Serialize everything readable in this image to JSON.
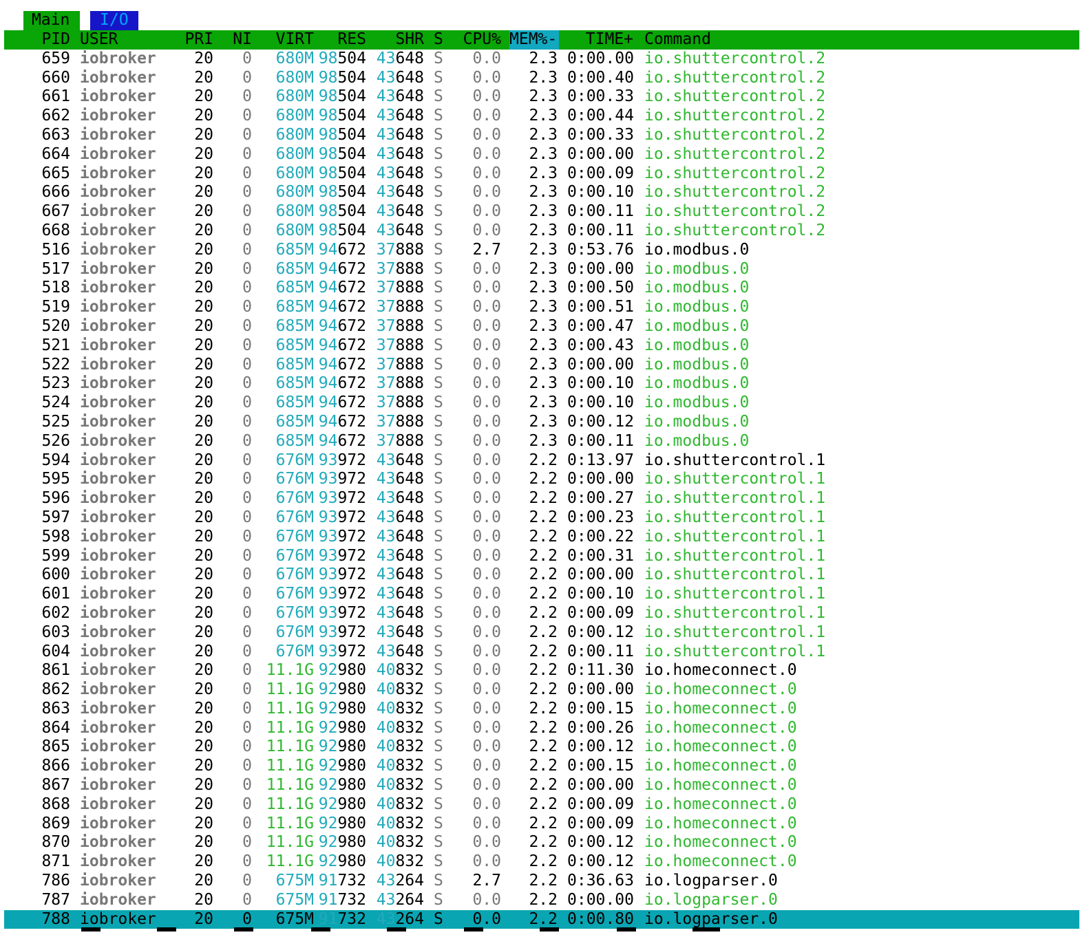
{
  "tabs": [
    {
      "label": "Main",
      "active": true
    },
    {
      "label": "I/O",
      "active": false
    }
  ],
  "colors": {
    "header_bg": "#0aa506",
    "tab_io_bg": "#1616c8",
    "selected_bg": "#0aa5b2",
    "sort_col_bg": "#11a8c0",
    "user_gray": "#777777",
    "cyan": "#22aabb",
    "thread_green": "#2fb82f"
  },
  "columns": [
    "PID",
    "USER",
    "PRI",
    "NI",
    "VIRT",
    "RES",
    "SHR",
    "S",
    "CPU%",
    "MEM%-",
    "TIME+",
    "Command"
  ],
  "sort_column": "MEM%-",
  "rows": [
    {
      "pid": "659",
      "user": "iobroker",
      "pri": "20",
      "ni": "0",
      "virt": "680M",
      "res_hi": "98",
      "res_lo": "504",
      "shr_hi": "43",
      "shr_lo": "648",
      "s": "S",
      "cpu": "0.0",
      "mem": "2.3",
      "time": "0:00.00",
      "cmd": "io.shuttercontrol.2",
      "thread": true
    },
    {
      "pid": "660",
      "user": "iobroker",
      "pri": "20",
      "ni": "0",
      "virt": "680M",
      "res_hi": "98",
      "res_lo": "504",
      "shr_hi": "43",
      "shr_lo": "648",
      "s": "S",
      "cpu": "0.0",
      "mem": "2.3",
      "time": "0:00.40",
      "cmd": "io.shuttercontrol.2",
      "thread": true
    },
    {
      "pid": "661",
      "user": "iobroker",
      "pri": "20",
      "ni": "0",
      "virt": "680M",
      "res_hi": "98",
      "res_lo": "504",
      "shr_hi": "43",
      "shr_lo": "648",
      "s": "S",
      "cpu": "0.0",
      "mem": "2.3",
      "time": "0:00.33",
      "cmd": "io.shuttercontrol.2",
      "thread": true
    },
    {
      "pid": "662",
      "user": "iobroker",
      "pri": "20",
      "ni": "0",
      "virt": "680M",
      "res_hi": "98",
      "res_lo": "504",
      "shr_hi": "43",
      "shr_lo": "648",
      "s": "S",
      "cpu": "0.0",
      "mem": "2.3",
      "time": "0:00.44",
      "cmd": "io.shuttercontrol.2",
      "thread": true
    },
    {
      "pid": "663",
      "user": "iobroker",
      "pri": "20",
      "ni": "0",
      "virt": "680M",
      "res_hi": "98",
      "res_lo": "504",
      "shr_hi": "43",
      "shr_lo": "648",
      "s": "S",
      "cpu": "0.0",
      "mem": "2.3",
      "time": "0:00.33",
      "cmd": "io.shuttercontrol.2",
      "thread": true
    },
    {
      "pid": "664",
      "user": "iobroker",
      "pri": "20",
      "ni": "0",
      "virt": "680M",
      "res_hi": "98",
      "res_lo": "504",
      "shr_hi": "43",
      "shr_lo": "648",
      "s": "S",
      "cpu": "0.0",
      "mem": "2.3",
      "time": "0:00.00",
      "cmd": "io.shuttercontrol.2",
      "thread": true
    },
    {
      "pid": "665",
      "user": "iobroker",
      "pri": "20",
      "ni": "0",
      "virt": "680M",
      "res_hi": "98",
      "res_lo": "504",
      "shr_hi": "43",
      "shr_lo": "648",
      "s": "S",
      "cpu": "0.0",
      "mem": "2.3",
      "time": "0:00.09",
      "cmd": "io.shuttercontrol.2",
      "thread": true
    },
    {
      "pid": "666",
      "user": "iobroker",
      "pri": "20",
      "ni": "0",
      "virt": "680M",
      "res_hi": "98",
      "res_lo": "504",
      "shr_hi": "43",
      "shr_lo": "648",
      "s": "S",
      "cpu": "0.0",
      "mem": "2.3",
      "time": "0:00.10",
      "cmd": "io.shuttercontrol.2",
      "thread": true
    },
    {
      "pid": "667",
      "user": "iobroker",
      "pri": "20",
      "ni": "0",
      "virt": "680M",
      "res_hi": "98",
      "res_lo": "504",
      "shr_hi": "43",
      "shr_lo": "648",
      "s": "S",
      "cpu": "0.0",
      "mem": "2.3",
      "time": "0:00.11",
      "cmd": "io.shuttercontrol.2",
      "thread": true
    },
    {
      "pid": "668",
      "user": "iobroker",
      "pri": "20",
      "ni": "0",
      "virt": "680M",
      "res_hi": "98",
      "res_lo": "504",
      "shr_hi": "43",
      "shr_lo": "648",
      "s": "S",
      "cpu": "0.0",
      "mem": "2.3",
      "time": "0:00.11",
      "cmd": "io.shuttercontrol.2",
      "thread": true
    },
    {
      "pid": "516",
      "user": "iobroker",
      "pri": "20",
      "ni": "0",
      "virt": "685M",
      "res_hi": "94",
      "res_lo": "672",
      "shr_hi": "37",
      "shr_lo": "888",
      "s": "S",
      "cpu": "2.7",
      "mem": "2.3",
      "time": "0:53.76",
      "cmd": "io.modbus.0",
      "thread": false
    },
    {
      "pid": "517",
      "user": "iobroker",
      "pri": "20",
      "ni": "0",
      "virt": "685M",
      "res_hi": "94",
      "res_lo": "672",
      "shr_hi": "37",
      "shr_lo": "888",
      "s": "S",
      "cpu": "0.0",
      "mem": "2.3",
      "time": "0:00.00",
      "cmd": "io.modbus.0",
      "thread": true
    },
    {
      "pid": "518",
      "user": "iobroker",
      "pri": "20",
      "ni": "0",
      "virt": "685M",
      "res_hi": "94",
      "res_lo": "672",
      "shr_hi": "37",
      "shr_lo": "888",
      "s": "S",
      "cpu": "0.0",
      "mem": "2.3",
      "time": "0:00.50",
      "cmd": "io.modbus.0",
      "thread": true
    },
    {
      "pid": "519",
      "user": "iobroker",
      "pri": "20",
      "ni": "0",
      "virt": "685M",
      "res_hi": "94",
      "res_lo": "672",
      "shr_hi": "37",
      "shr_lo": "888",
      "s": "S",
      "cpu": "0.0",
      "mem": "2.3",
      "time": "0:00.51",
      "cmd": "io.modbus.0",
      "thread": true
    },
    {
      "pid": "520",
      "user": "iobroker",
      "pri": "20",
      "ni": "0",
      "virt": "685M",
      "res_hi": "94",
      "res_lo": "672",
      "shr_hi": "37",
      "shr_lo": "888",
      "s": "S",
      "cpu": "0.0",
      "mem": "2.3",
      "time": "0:00.47",
      "cmd": "io.modbus.0",
      "thread": true
    },
    {
      "pid": "521",
      "user": "iobroker",
      "pri": "20",
      "ni": "0",
      "virt": "685M",
      "res_hi": "94",
      "res_lo": "672",
      "shr_hi": "37",
      "shr_lo": "888",
      "s": "S",
      "cpu": "0.0",
      "mem": "2.3",
      "time": "0:00.43",
      "cmd": "io.modbus.0",
      "thread": true
    },
    {
      "pid": "522",
      "user": "iobroker",
      "pri": "20",
      "ni": "0",
      "virt": "685M",
      "res_hi": "94",
      "res_lo": "672",
      "shr_hi": "37",
      "shr_lo": "888",
      "s": "S",
      "cpu": "0.0",
      "mem": "2.3",
      "time": "0:00.00",
      "cmd": "io.modbus.0",
      "thread": true
    },
    {
      "pid": "523",
      "user": "iobroker",
      "pri": "20",
      "ni": "0",
      "virt": "685M",
      "res_hi": "94",
      "res_lo": "672",
      "shr_hi": "37",
      "shr_lo": "888",
      "s": "S",
      "cpu": "0.0",
      "mem": "2.3",
      "time": "0:00.10",
      "cmd": "io.modbus.0",
      "thread": true
    },
    {
      "pid": "524",
      "user": "iobroker",
      "pri": "20",
      "ni": "0",
      "virt": "685M",
      "res_hi": "94",
      "res_lo": "672",
      "shr_hi": "37",
      "shr_lo": "888",
      "s": "S",
      "cpu": "0.0",
      "mem": "2.3",
      "time": "0:00.10",
      "cmd": "io.modbus.0",
      "thread": true
    },
    {
      "pid": "525",
      "user": "iobroker",
      "pri": "20",
      "ni": "0",
      "virt": "685M",
      "res_hi": "94",
      "res_lo": "672",
      "shr_hi": "37",
      "shr_lo": "888",
      "s": "S",
      "cpu": "0.0",
      "mem": "2.3",
      "time": "0:00.12",
      "cmd": "io.modbus.0",
      "thread": true
    },
    {
      "pid": "526",
      "user": "iobroker",
      "pri": "20",
      "ni": "0",
      "virt": "685M",
      "res_hi": "94",
      "res_lo": "672",
      "shr_hi": "37",
      "shr_lo": "888",
      "s": "S",
      "cpu": "0.0",
      "mem": "2.3",
      "time": "0:00.11",
      "cmd": "io.modbus.0",
      "thread": true
    },
    {
      "pid": "594",
      "user": "iobroker",
      "pri": "20",
      "ni": "0",
      "virt": "676M",
      "res_hi": "93",
      "res_lo": "972",
      "shr_hi": "43",
      "shr_lo": "648",
      "s": "S",
      "cpu": "0.0",
      "mem": "2.2",
      "time": "0:13.97",
      "cmd": "io.shuttercontrol.1",
      "thread": false
    },
    {
      "pid": "595",
      "user": "iobroker",
      "pri": "20",
      "ni": "0",
      "virt": "676M",
      "res_hi": "93",
      "res_lo": "972",
      "shr_hi": "43",
      "shr_lo": "648",
      "s": "S",
      "cpu": "0.0",
      "mem": "2.2",
      "time": "0:00.00",
      "cmd": "io.shuttercontrol.1",
      "thread": true
    },
    {
      "pid": "596",
      "user": "iobroker",
      "pri": "20",
      "ni": "0",
      "virt": "676M",
      "res_hi": "93",
      "res_lo": "972",
      "shr_hi": "43",
      "shr_lo": "648",
      "s": "S",
      "cpu": "0.0",
      "mem": "2.2",
      "time": "0:00.27",
      "cmd": "io.shuttercontrol.1",
      "thread": true
    },
    {
      "pid": "597",
      "user": "iobroker",
      "pri": "20",
      "ni": "0",
      "virt": "676M",
      "res_hi": "93",
      "res_lo": "972",
      "shr_hi": "43",
      "shr_lo": "648",
      "s": "S",
      "cpu": "0.0",
      "mem": "2.2",
      "time": "0:00.23",
      "cmd": "io.shuttercontrol.1",
      "thread": true
    },
    {
      "pid": "598",
      "user": "iobroker",
      "pri": "20",
      "ni": "0",
      "virt": "676M",
      "res_hi": "93",
      "res_lo": "972",
      "shr_hi": "43",
      "shr_lo": "648",
      "s": "S",
      "cpu": "0.0",
      "mem": "2.2",
      "time": "0:00.22",
      "cmd": "io.shuttercontrol.1",
      "thread": true
    },
    {
      "pid": "599",
      "user": "iobroker",
      "pri": "20",
      "ni": "0",
      "virt": "676M",
      "res_hi": "93",
      "res_lo": "972",
      "shr_hi": "43",
      "shr_lo": "648",
      "s": "S",
      "cpu": "0.0",
      "mem": "2.2",
      "time": "0:00.31",
      "cmd": "io.shuttercontrol.1",
      "thread": true
    },
    {
      "pid": "600",
      "user": "iobroker",
      "pri": "20",
      "ni": "0",
      "virt": "676M",
      "res_hi": "93",
      "res_lo": "972",
      "shr_hi": "43",
      "shr_lo": "648",
      "s": "S",
      "cpu": "0.0",
      "mem": "2.2",
      "time": "0:00.00",
      "cmd": "io.shuttercontrol.1",
      "thread": true
    },
    {
      "pid": "601",
      "user": "iobroker",
      "pri": "20",
      "ni": "0",
      "virt": "676M",
      "res_hi": "93",
      "res_lo": "972",
      "shr_hi": "43",
      "shr_lo": "648",
      "s": "S",
      "cpu": "0.0",
      "mem": "2.2",
      "time": "0:00.10",
      "cmd": "io.shuttercontrol.1",
      "thread": true
    },
    {
      "pid": "602",
      "user": "iobroker",
      "pri": "20",
      "ni": "0",
      "virt": "676M",
      "res_hi": "93",
      "res_lo": "972",
      "shr_hi": "43",
      "shr_lo": "648",
      "s": "S",
      "cpu": "0.0",
      "mem": "2.2",
      "time": "0:00.09",
      "cmd": "io.shuttercontrol.1",
      "thread": true
    },
    {
      "pid": "603",
      "user": "iobroker",
      "pri": "20",
      "ni": "0",
      "virt": "676M",
      "res_hi": "93",
      "res_lo": "972",
      "shr_hi": "43",
      "shr_lo": "648",
      "s": "S",
      "cpu": "0.0",
      "mem": "2.2",
      "time": "0:00.12",
      "cmd": "io.shuttercontrol.1",
      "thread": true
    },
    {
      "pid": "604",
      "user": "iobroker",
      "pri": "20",
      "ni": "0",
      "virt": "676M",
      "res_hi": "93",
      "res_lo": "972",
      "shr_hi": "43",
      "shr_lo": "648",
      "s": "S",
      "cpu": "0.0",
      "mem": "2.2",
      "time": "0:00.11",
      "cmd": "io.shuttercontrol.1",
      "thread": true
    },
    {
      "pid": "861",
      "user": "iobroker",
      "pri": "20",
      "ni": "0",
      "virt": "11.1G",
      "res_hi": "92",
      "res_lo": "980",
      "shr_hi": "40",
      "shr_lo": "832",
      "s": "S",
      "cpu": "0.0",
      "mem": "2.2",
      "time": "0:11.30",
      "cmd": "io.homeconnect.0",
      "thread": false,
      "virt_green": true
    },
    {
      "pid": "862",
      "user": "iobroker",
      "pri": "20",
      "ni": "0",
      "virt": "11.1G",
      "res_hi": "92",
      "res_lo": "980",
      "shr_hi": "40",
      "shr_lo": "832",
      "s": "S",
      "cpu": "0.0",
      "mem": "2.2",
      "time": "0:00.00",
      "cmd": "io.homeconnect.0",
      "thread": true,
      "virt_green": true
    },
    {
      "pid": "863",
      "user": "iobroker",
      "pri": "20",
      "ni": "0",
      "virt": "11.1G",
      "res_hi": "92",
      "res_lo": "980",
      "shr_hi": "40",
      "shr_lo": "832",
      "s": "S",
      "cpu": "0.0",
      "mem": "2.2",
      "time": "0:00.15",
      "cmd": "io.homeconnect.0",
      "thread": true,
      "virt_green": true
    },
    {
      "pid": "864",
      "user": "iobroker",
      "pri": "20",
      "ni": "0",
      "virt": "11.1G",
      "res_hi": "92",
      "res_lo": "980",
      "shr_hi": "40",
      "shr_lo": "832",
      "s": "S",
      "cpu": "0.0",
      "mem": "2.2",
      "time": "0:00.26",
      "cmd": "io.homeconnect.0",
      "thread": true,
      "virt_green": true
    },
    {
      "pid": "865",
      "user": "iobroker",
      "pri": "20",
      "ni": "0",
      "virt": "11.1G",
      "res_hi": "92",
      "res_lo": "980",
      "shr_hi": "40",
      "shr_lo": "832",
      "s": "S",
      "cpu": "0.0",
      "mem": "2.2",
      "time": "0:00.12",
      "cmd": "io.homeconnect.0",
      "thread": true,
      "virt_green": true
    },
    {
      "pid": "866",
      "user": "iobroker",
      "pri": "20",
      "ni": "0",
      "virt": "11.1G",
      "res_hi": "92",
      "res_lo": "980",
      "shr_hi": "40",
      "shr_lo": "832",
      "s": "S",
      "cpu": "0.0",
      "mem": "2.2",
      "time": "0:00.15",
      "cmd": "io.homeconnect.0",
      "thread": true,
      "virt_green": true
    },
    {
      "pid": "867",
      "user": "iobroker",
      "pri": "20",
      "ni": "0",
      "virt": "11.1G",
      "res_hi": "92",
      "res_lo": "980",
      "shr_hi": "40",
      "shr_lo": "832",
      "s": "S",
      "cpu": "0.0",
      "mem": "2.2",
      "time": "0:00.00",
      "cmd": "io.homeconnect.0",
      "thread": true,
      "virt_green": true
    },
    {
      "pid": "868",
      "user": "iobroker",
      "pri": "20",
      "ni": "0",
      "virt": "11.1G",
      "res_hi": "92",
      "res_lo": "980",
      "shr_hi": "40",
      "shr_lo": "832",
      "s": "S",
      "cpu": "0.0",
      "mem": "2.2",
      "time": "0:00.09",
      "cmd": "io.homeconnect.0",
      "thread": true,
      "virt_green": true
    },
    {
      "pid": "869",
      "user": "iobroker",
      "pri": "20",
      "ni": "0",
      "virt": "11.1G",
      "res_hi": "92",
      "res_lo": "980",
      "shr_hi": "40",
      "shr_lo": "832",
      "s": "S",
      "cpu": "0.0",
      "mem": "2.2",
      "time": "0:00.09",
      "cmd": "io.homeconnect.0",
      "thread": true,
      "virt_green": true
    },
    {
      "pid": "870",
      "user": "iobroker",
      "pri": "20",
      "ni": "0",
      "virt": "11.1G",
      "res_hi": "92",
      "res_lo": "980",
      "shr_hi": "40",
      "shr_lo": "832",
      "s": "S",
      "cpu": "0.0",
      "mem": "2.2",
      "time": "0:00.12",
      "cmd": "io.homeconnect.0",
      "thread": true,
      "virt_green": true
    },
    {
      "pid": "871",
      "user": "iobroker",
      "pri": "20",
      "ni": "0",
      "virt": "11.1G",
      "res_hi": "92",
      "res_lo": "980",
      "shr_hi": "40",
      "shr_lo": "832",
      "s": "S",
      "cpu": "0.0",
      "mem": "2.2",
      "time": "0:00.12",
      "cmd": "io.homeconnect.0",
      "thread": true,
      "virt_green": true
    },
    {
      "pid": "786",
      "user": "iobroker",
      "pri": "20",
      "ni": "0",
      "virt": "675M",
      "res_hi": "91",
      "res_lo": "732",
      "shr_hi": "43",
      "shr_lo": "264",
      "s": "S",
      "cpu": "2.7",
      "mem": "2.2",
      "time": "0:36.63",
      "cmd": "io.logparser.0",
      "thread": false
    },
    {
      "pid": "787",
      "user": "iobroker",
      "pri": "20",
      "ni": "0",
      "virt": "675M",
      "res_hi": "91",
      "res_lo": "732",
      "shr_hi": "43",
      "shr_lo": "264",
      "s": "S",
      "cpu": "0.0",
      "mem": "2.2",
      "time": "0:00.00",
      "cmd": "io.logparser.0",
      "thread": true
    },
    {
      "pid": "788",
      "user": "iobroker",
      "pri": "20",
      "ni": "0",
      "virt": "675M",
      "res_hi": "91",
      "res_lo": "732",
      "shr_hi": "43",
      "shr_lo": "264",
      "s": "S",
      "cpu": "0.0",
      "mem": "2.2",
      "time": "0:00.80",
      "cmd": "io.logparser.0",
      "thread": true,
      "selected": true
    }
  ]
}
